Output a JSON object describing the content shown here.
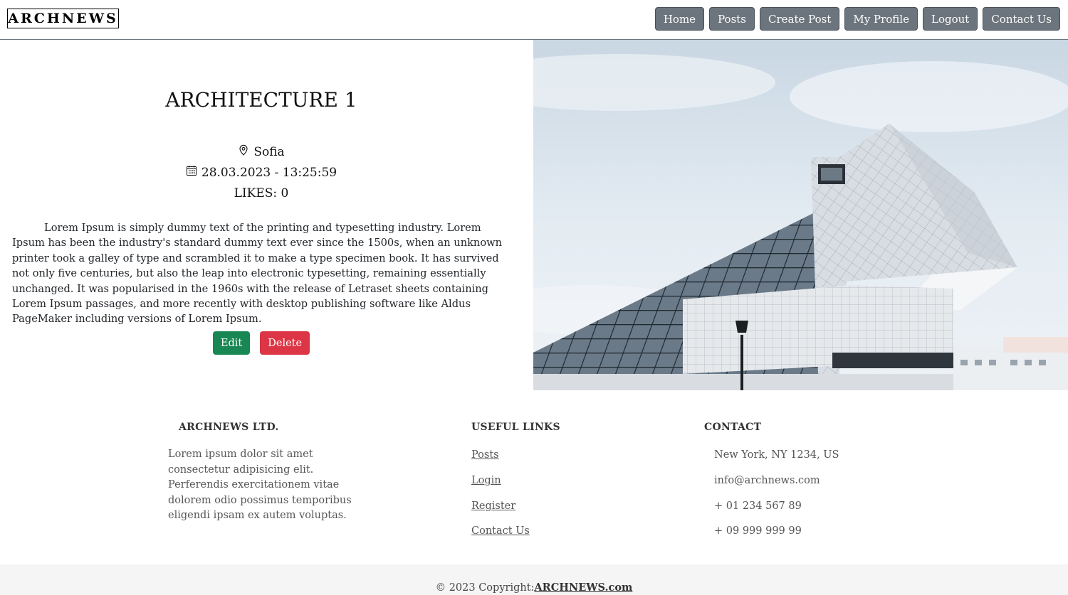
{
  "navbar": {
    "logo": "ARCHNEWS",
    "items": [
      {
        "label": "Home"
      },
      {
        "label": "Posts"
      },
      {
        "label": "Create Post"
      },
      {
        "label": "My Profile"
      },
      {
        "label": "Logout"
      },
      {
        "label": "Contact Us"
      }
    ],
    "button_color": "#6c757d"
  },
  "article": {
    "title": "ARCHITECTURE 1",
    "location": "Sofia",
    "datetime": "28.03.2023 - 13:25:59",
    "likes": "LIKES: 0",
    "body": "Lorem Ipsum is simply dummy text of the printing and typesetting industry. Lorem Ipsum has been the industry's standard dummy text ever since the 1500s, when an unknown printer took a galley of type and scrambled it to make a type specimen book. It has survived not only five centuries, but also the leap into electronic typesetting, remaining essentially unchanged. It was popularised in the 1960s with the release of Letraset sheets containing Lorem Ipsum passages, and more recently with desktop publishing software like Aldus PageMaker including versions of Lorem Ipsum.",
    "edit_label": "Edit",
    "delete_label": "Delete",
    "edit_color": "#198754",
    "delete_color": "#dc3545",
    "location_icon": "map-pin-icon",
    "date_icon": "calendar-icon"
  },
  "footer": {
    "company": {
      "heading": "ARCHNEWS LTD.",
      "description": "Lorem ipsum dolor sit amet consectetur adipisicing elit. Perferendis exercitationem vitae dolorem odio possimus temporibus eligendi ipsam ex autem voluptas."
    },
    "links": {
      "heading": "USEFUL LINKS",
      "items": [
        "Posts",
        "Login",
        "Register",
        "Contact Us"
      ]
    },
    "contact": {
      "heading": "CONTACT",
      "address": "New York, NY 1234, US",
      "email": "info@archnews.com",
      "phone1": "+ 01 234 567 89",
      "phone2": "+ 09 999 999 99"
    },
    "copyright_text": "© 2023 Copyright:",
    "copyright_link": "ARCHNEWS.com"
  }
}
